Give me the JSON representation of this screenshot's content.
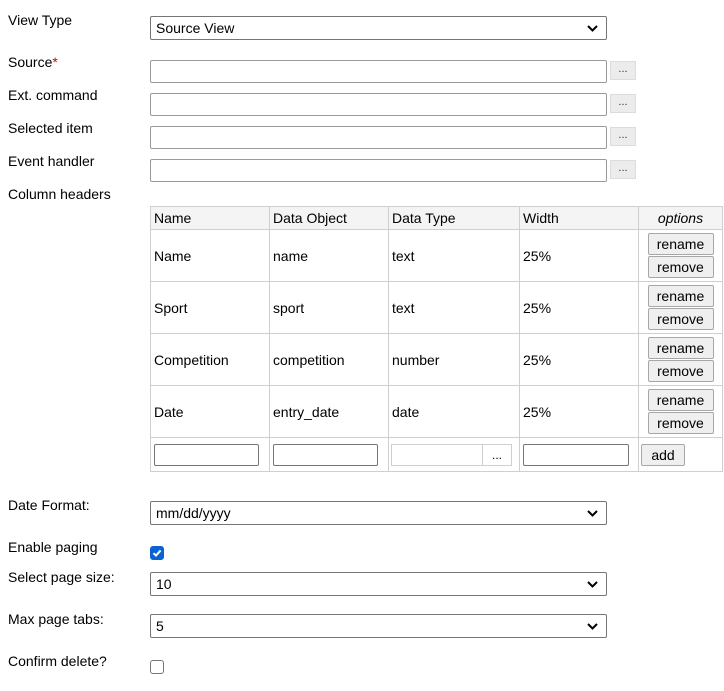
{
  "view_type": {
    "label": "View Type",
    "value": "Source View"
  },
  "source": {
    "label": "Source",
    "required_mark": "*",
    "value": "",
    "browse_label": "..."
  },
  "ext_command": {
    "label": "Ext. command",
    "value": "",
    "browse_label": "..."
  },
  "selected_item": {
    "label": "Selected item",
    "value": "",
    "browse_label": "..."
  },
  "event_handler": {
    "label": "Event handler",
    "value": "",
    "browse_label": "..."
  },
  "column_headers": {
    "label": "Column headers",
    "headers": [
      "Name",
      "Data Object",
      "Data Type",
      "Width",
      "options"
    ],
    "rows": [
      {
        "name": "Name",
        "data_object": "name",
        "data_type": "text",
        "width": "25%"
      },
      {
        "name": "Sport",
        "data_object": "sport",
        "data_type": "text",
        "width": "25%"
      },
      {
        "name": "Competition",
        "data_object": "competition",
        "data_type": "number",
        "width": "25%"
      },
      {
        "name": "Date",
        "data_object": "entry_date",
        "data_type": "date",
        "width": "25%"
      }
    ],
    "rename_label": "rename",
    "remove_label": "remove",
    "add_label": "add",
    "type_browse_label": "..."
  },
  "date_format": {
    "label": "Date Format:",
    "value": "mm/dd/yyyy"
  },
  "enable_paging": {
    "label": "Enable paging",
    "checked": true
  },
  "page_size": {
    "label": "Select page size:",
    "value": "10"
  },
  "max_page_tabs": {
    "label": "Max page tabs:",
    "value": "5"
  },
  "confirm_delete": {
    "label": "Confirm delete?",
    "checked": false
  },
  "colors": {
    "checkbox_on": "#0b63d1",
    "required": "#d00000"
  }
}
